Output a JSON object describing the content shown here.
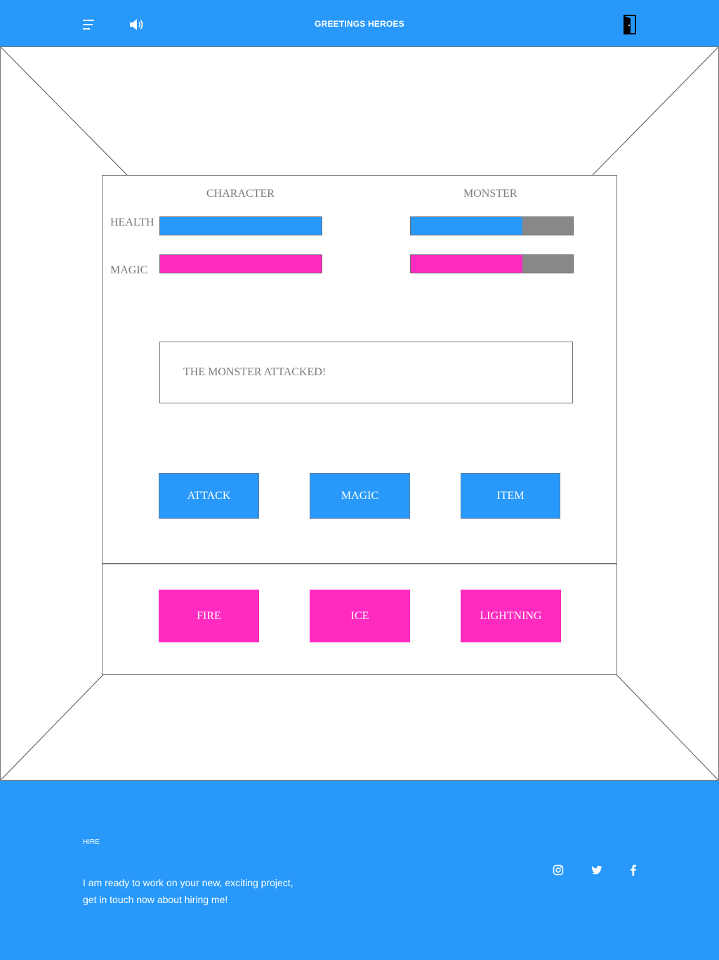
{
  "header": {
    "title": "GREETINGS HEROES",
    "menu_icon": "hamburger-menu-icon",
    "sound_icon": "speaker-volume-icon",
    "exit_icon": "door-exit-icon"
  },
  "battle": {
    "character_label": "CHARACTER",
    "monster_label": "MONSTER",
    "health_label": "HEALTH",
    "magic_label": "MAGIC",
    "character": {
      "health_fraction": 1.0,
      "magic_fraction": 1.0
    },
    "monster": {
      "health_fraction": 0.69,
      "magic_fraction": 0.69
    },
    "message": "THE MONSTER ATTACKED!",
    "actions": [
      "ATTACK",
      "MAGIC",
      "ITEM"
    ],
    "spells": [
      "FIRE",
      "ICE",
      "LIGHTNING"
    ]
  },
  "footer": {
    "label": "HIRE",
    "text_line1": "I am ready to work on your new, exciting project,",
    "text_line2": "get in touch now about hiring me!",
    "social_icons": [
      "instagram-icon",
      "twitter-icon",
      "facebook-icon"
    ]
  },
  "colors": {
    "primary_blue": "#2899FA",
    "magic_pink": "#FF2AC0",
    "empty_gray": "#888888",
    "text_gray": "#7A7A7A"
  }
}
